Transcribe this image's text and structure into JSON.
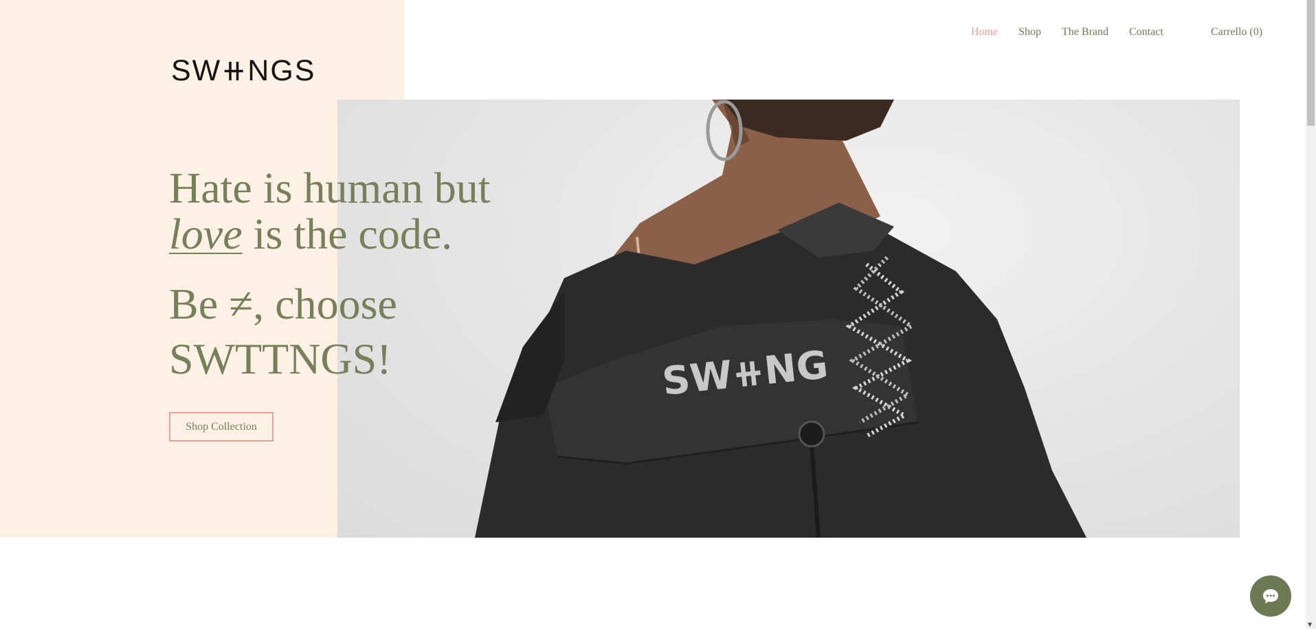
{
  "brand": {
    "logo_text": "SW⧺NGS"
  },
  "nav": {
    "items": [
      {
        "label": "Home",
        "active": true
      },
      {
        "label": "Shop",
        "active": false
      },
      {
        "label": "The Brand",
        "active": false
      },
      {
        "label": "Contact",
        "active": false
      }
    ],
    "cart_label": "Carrello (0)"
  },
  "hero": {
    "line1": "Hate is human but",
    "love_word": "love",
    "line2_rest": " is the code.",
    "subline1": "Be ≠, choose",
    "subline2": "SWTTNGS!",
    "cta_label": "Shop Collection",
    "jacket_text": "SW⧺NG"
  },
  "colors": {
    "accent_green": "#76805b",
    "accent_pink": "#e0a092",
    "panel_peach": "#fdf0e5",
    "chat_bg": "#6b7a53"
  },
  "icons": {
    "chat": "chat-bubble-icon",
    "scroll_down": "scroll-down-arrow-icon"
  }
}
